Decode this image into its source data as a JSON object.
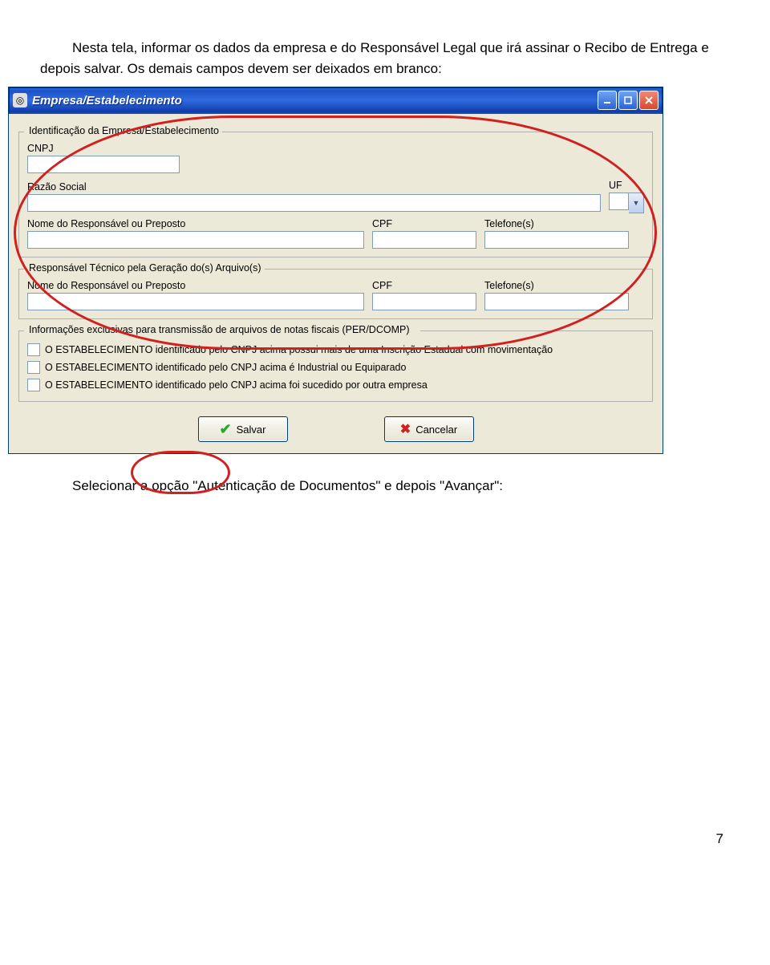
{
  "instruction_top": "Nesta tela, informar os dados da empresa e do Responsável Legal que irá assinar o Recibo de Entrega e depois salvar. Os demais campos devem ser deixados em branco:",
  "instruction_bottom": "Selecionar a opção \"Autenticação de Documentos\" e depois \"Avançar\":",
  "page_number": "7",
  "window": {
    "title": "Empresa/Estabelecimento",
    "group1": {
      "title": "Identificação da Empresa/Estabelecimento",
      "cnpj_label": "CNPJ",
      "razao_label": "Razão Social",
      "uf_label": "UF",
      "resp_label": "Nome do Responsável ou Preposto",
      "cpf_label": "CPF",
      "tel_label": "Telefone(s)"
    },
    "group2": {
      "title": "Responsável Técnico pela Geração do(s) Arquivo(s)",
      "resp_label": "Nome do Responsável ou Preposto",
      "cpf_label": "CPF",
      "tel_label": "Telefone(s)"
    },
    "group3": {
      "title": "Informações exclusivas para transmissão de arquivos de notas fiscais (PER/DCOMP)",
      "chk1": "O ESTABELECIMENTO identificado pelo CNPJ acima possui mais de uma Inscrição Estadual com movimentação",
      "chk2": "O ESTABELECIMENTO identificado pelo CNPJ acima é Industrial ou Equiparado",
      "chk3": "O ESTABELECIMENTO identificado pelo CNPJ acima foi sucedido por outra empresa"
    },
    "buttons": {
      "save": "Salvar",
      "cancel": "Cancelar"
    }
  }
}
